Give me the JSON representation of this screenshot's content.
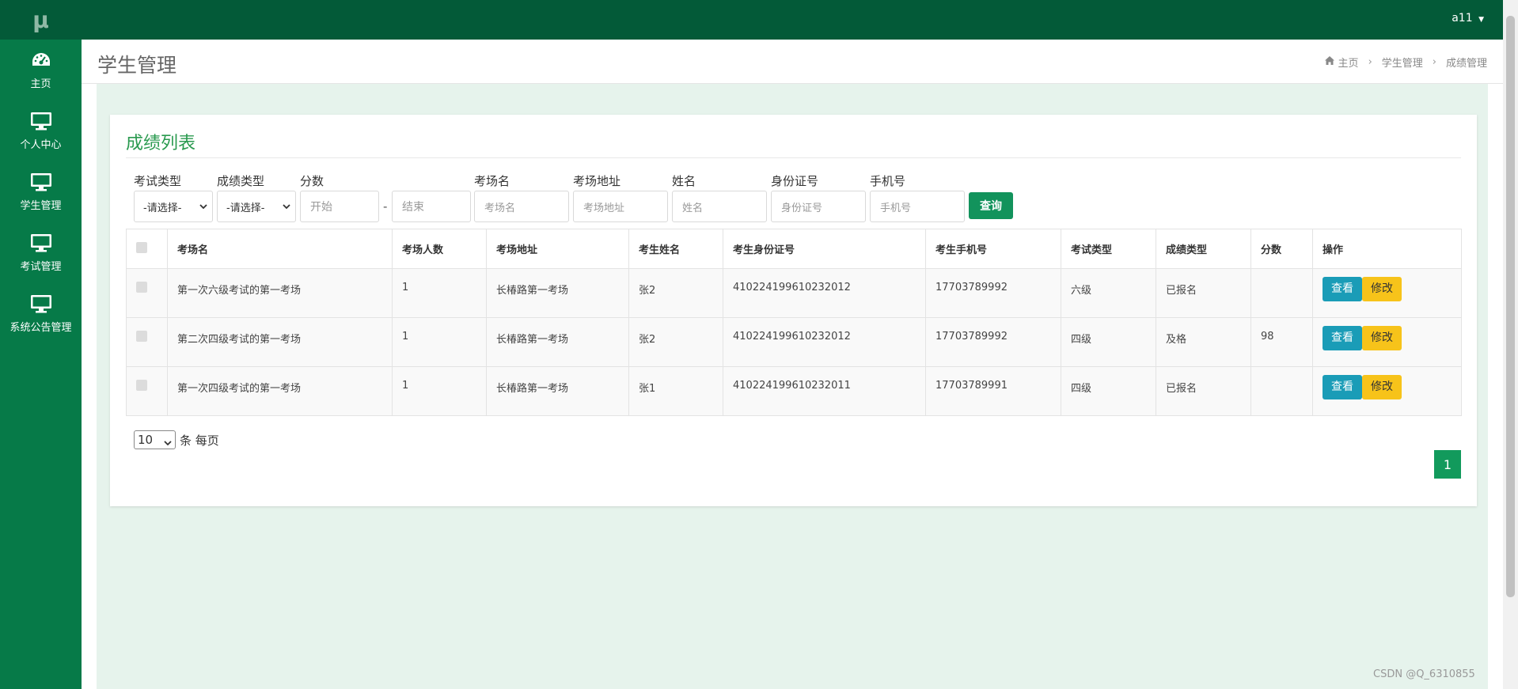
{
  "sidebar": {
    "logo": "μ",
    "items": [
      {
        "label": "主页",
        "icon": "dashboard-icon"
      },
      {
        "label": "个人中心",
        "icon": "monitor-icon"
      },
      {
        "label": "学生管理",
        "icon": "monitor-icon"
      },
      {
        "label": "考试管理",
        "icon": "monitor-icon"
      },
      {
        "label": "系统公告管理",
        "icon": "monitor-icon"
      }
    ]
  },
  "topbar": {
    "user": "a11"
  },
  "header": {
    "title": "学生管理",
    "breadcrumb": [
      "主页",
      "学生管理",
      "成绩管理"
    ]
  },
  "card": {
    "title": "成绩列表"
  },
  "filters": {
    "exam_type": {
      "label": "考试类型",
      "value": "-请选择-"
    },
    "score_type": {
      "label": "成绩类型",
      "value": "-请选择-"
    },
    "score": {
      "label": "分数",
      "start_placeholder": "开始",
      "end_placeholder": "结束",
      "separator": "-"
    },
    "venue_name": {
      "label": "考场名",
      "placeholder": "考场名"
    },
    "venue_address": {
      "label": "考场地址",
      "placeholder": "考场地址"
    },
    "name": {
      "label": "姓名",
      "placeholder": "姓名"
    },
    "id_card": {
      "label": "身份证号",
      "placeholder": "身份证号"
    },
    "phone": {
      "label": "手机号",
      "placeholder": "手机号"
    },
    "query_label": "查询"
  },
  "table": {
    "headers": [
      "考场名",
      "考场人数",
      "考场地址",
      "考生姓名",
      "考生身份证号",
      "考生手机号",
      "考试类型",
      "成绩类型",
      "分数",
      "操作"
    ],
    "rows": [
      [
        "第一次六级考试的第一考场",
        "1",
        "长椿路第一考场",
        "张2",
        "410224199610232012",
        "17703789992",
        "六级",
        "已报名",
        ""
      ],
      [
        "第二次四级考试的第一考场",
        "1",
        "长椿路第一考场",
        "张2",
        "410224199610232012",
        "17703789992",
        "四级",
        "及格",
        "98"
      ],
      [
        "第一次四级考试的第一考场",
        "1",
        "长椿路第一考场",
        "张1",
        "410224199610232011",
        "17703789991",
        "四级",
        "已报名",
        ""
      ]
    ],
    "view_label": "查看",
    "edit_label": "修改"
  },
  "pagination": {
    "page_size": "10",
    "page_size_suffix": "条 每页",
    "current_page": "1"
  },
  "watermark": "CSDN @Q_6310855",
  "colors": {
    "sidebar": "#067a48",
    "topbar": "#035a38",
    "accent": "#12935c",
    "view": "#1a9cb7",
    "edit": "#f7c31a"
  }
}
